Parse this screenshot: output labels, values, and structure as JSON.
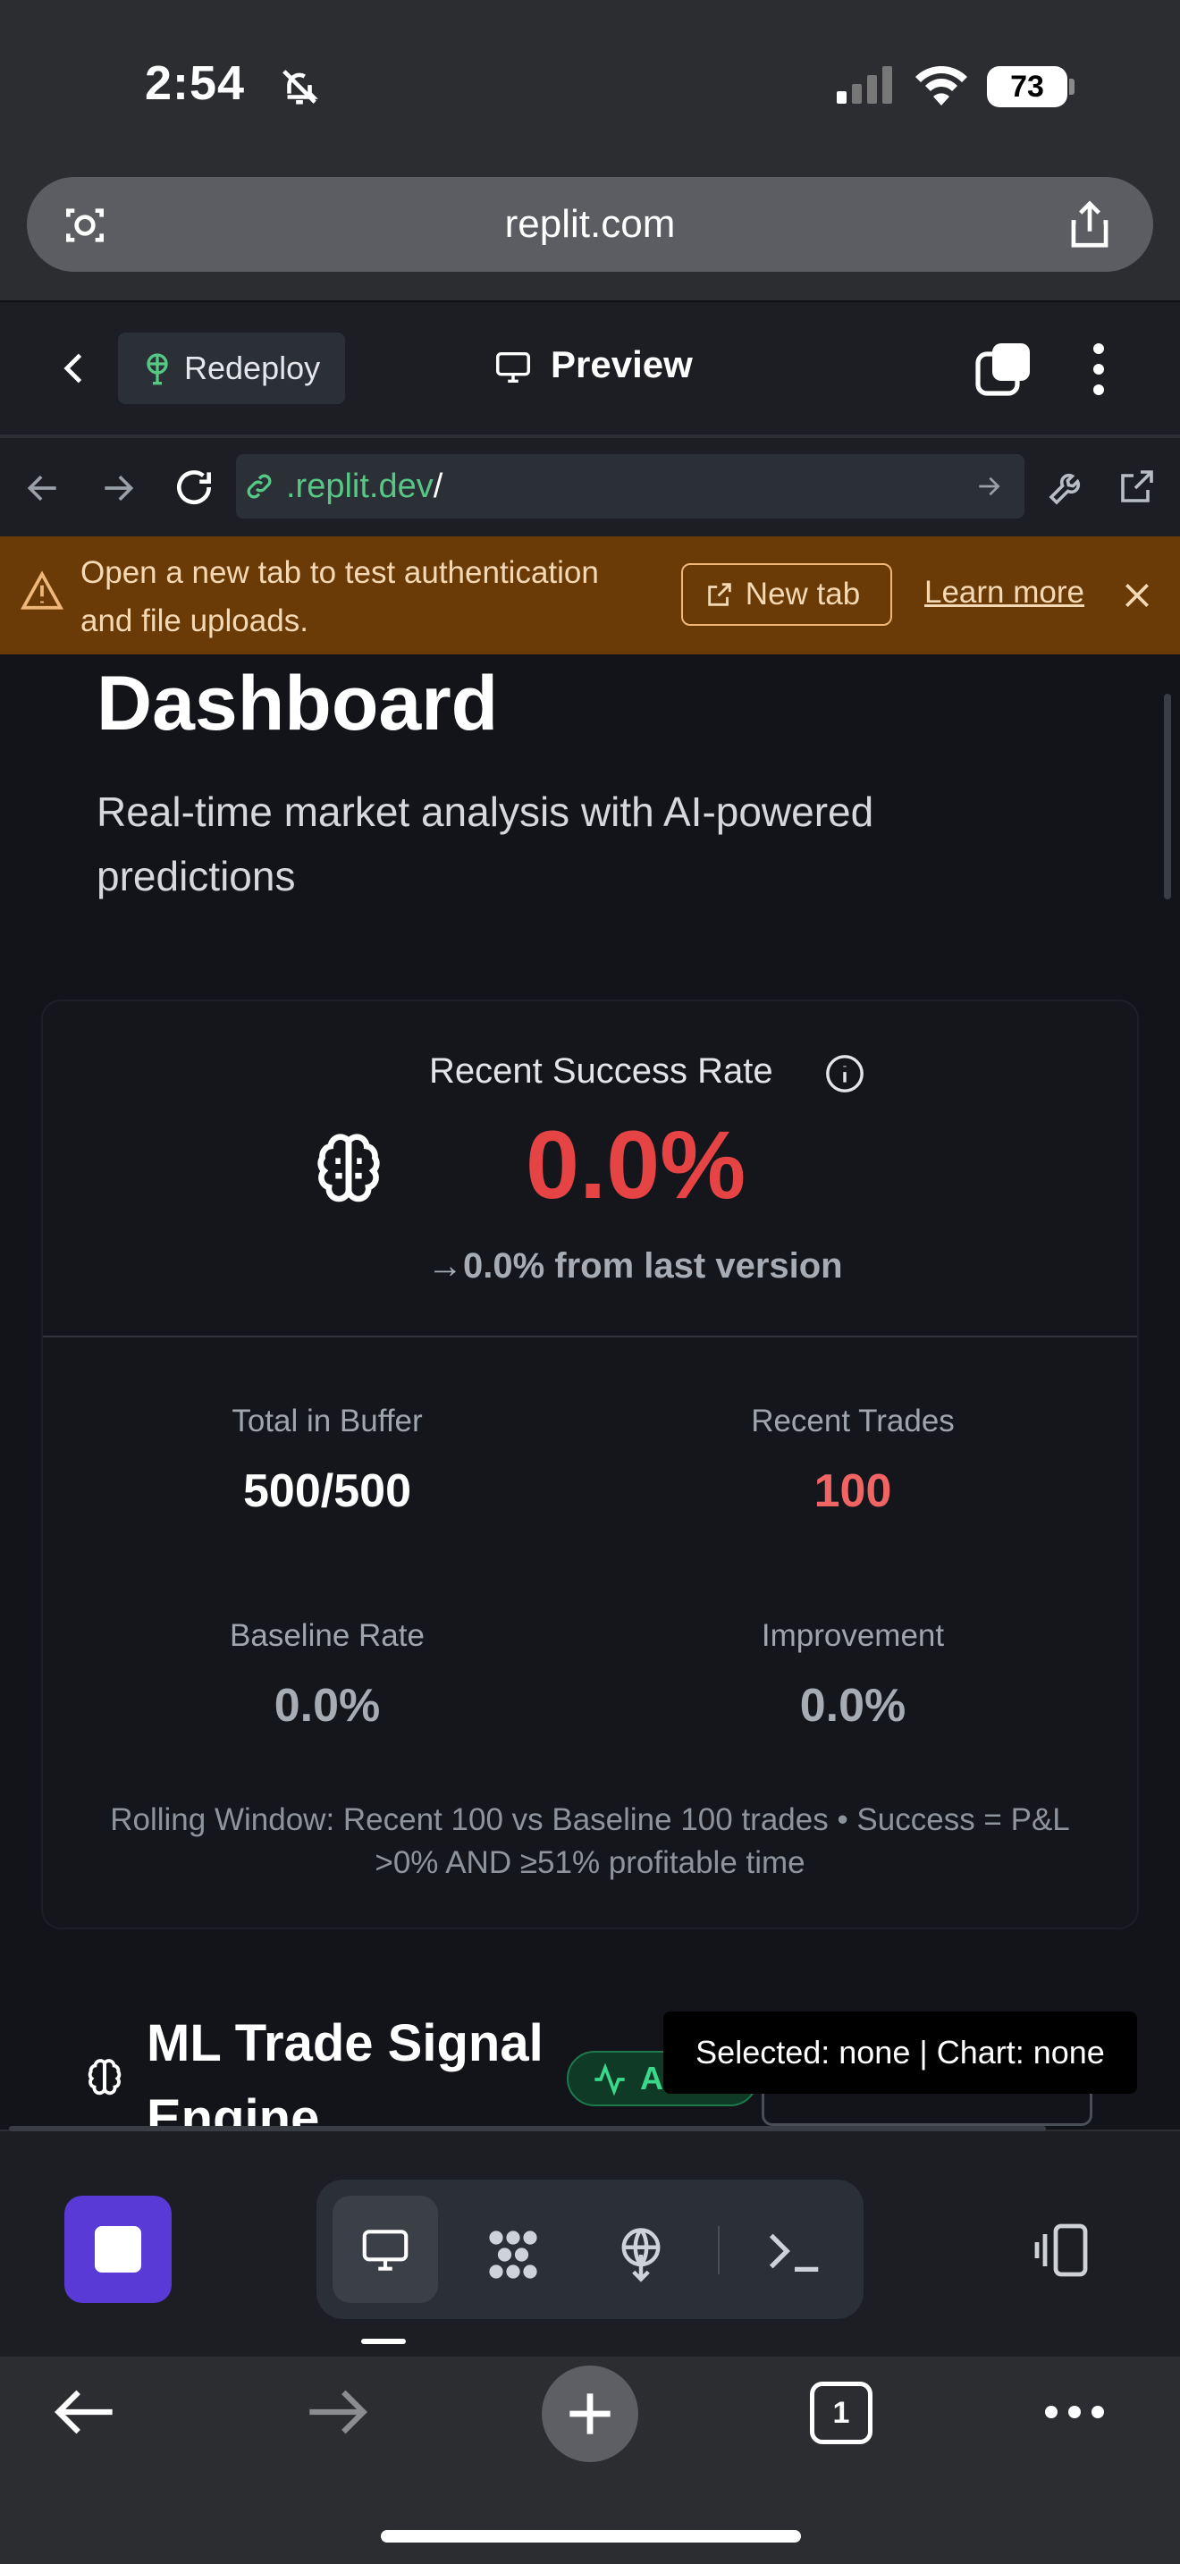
{
  "status_bar": {
    "time": "2:54",
    "battery": "73"
  },
  "browser": {
    "url": "replit.com"
  },
  "replit_header": {
    "redeploy_label": "Redeploy",
    "preview_label": "Preview"
  },
  "webview_bar": {
    "address_domain": ".replit.dev",
    "address_path": "/"
  },
  "banner": {
    "message": "Open a new tab to test authentication and file uploads.",
    "new_tab_label": "New tab",
    "learn_more_label": "Learn more"
  },
  "page": {
    "title": "Dashboard",
    "subtitle": "Real-time market analysis with AI-powered predictions"
  },
  "success_card": {
    "label": "Recent Success Rate",
    "rate": "0.0%",
    "change": "→0.0% from last version",
    "stats": [
      {
        "label": "Total in Buffer",
        "value": "500/500"
      },
      {
        "label": "Recent Trades",
        "value": "100"
      },
      {
        "label": "Baseline Rate",
        "value": "0.0%"
      },
      {
        "label": "Improvement",
        "value": "0.0%"
      }
    ],
    "note": "Rolling Window: Recent 100 vs Baseline 100 trades • Success = P&L >0% AND ≥51% profitable time"
  },
  "ml_section": {
    "title": "ML Trade Signal Engine",
    "status_badge": "Active",
    "tooltip": "Selected: none | Chart: none"
  },
  "safari_toolbar": {
    "tab_count": "1"
  },
  "colors": {
    "negative": "#e64444",
    "accent": "#5a3ad6",
    "positive": "#39d88a",
    "banner_bg": "#6a3b07"
  }
}
